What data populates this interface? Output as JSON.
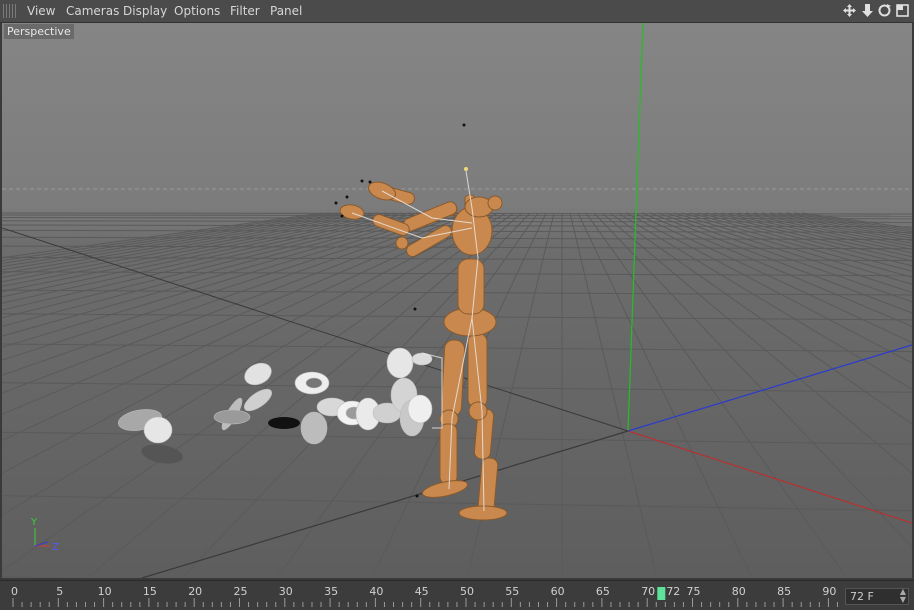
{
  "menubar": {
    "items": [
      "View",
      "Cameras",
      "Display",
      "Options",
      "Filter",
      "Panel"
    ],
    "nav_icons": [
      "move-view-icon",
      "dolly-view-icon",
      "rotate-view-icon",
      "maximize-view-icon"
    ]
  },
  "viewport": {
    "label": "Perspective",
    "axis_y": "Y",
    "axis_z": "Z",
    "colors": {
      "grid": "#565656",
      "x_axis": "#c03030",
      "y_axis": "#20c020",
      "z_axis": "#2030c0",
      "figure": "#c8894f"
    }
  },
  "timeline": {
    "ticks": [
      "0",
      "5",
      "10",
      "15",
      "20",
      "25",
      "30",
      "35",
      "40",
      "45",
      "50",
      "55",
      "60",
      "65",
      "70",
      "75",
      "80",
      "85",
      "90"
    ],
    "current_frame": "72",
    "current_frame_value": 72,
    "frame_field": "72 F",
    "playhead_color": "#5ee29a"
  }
}
